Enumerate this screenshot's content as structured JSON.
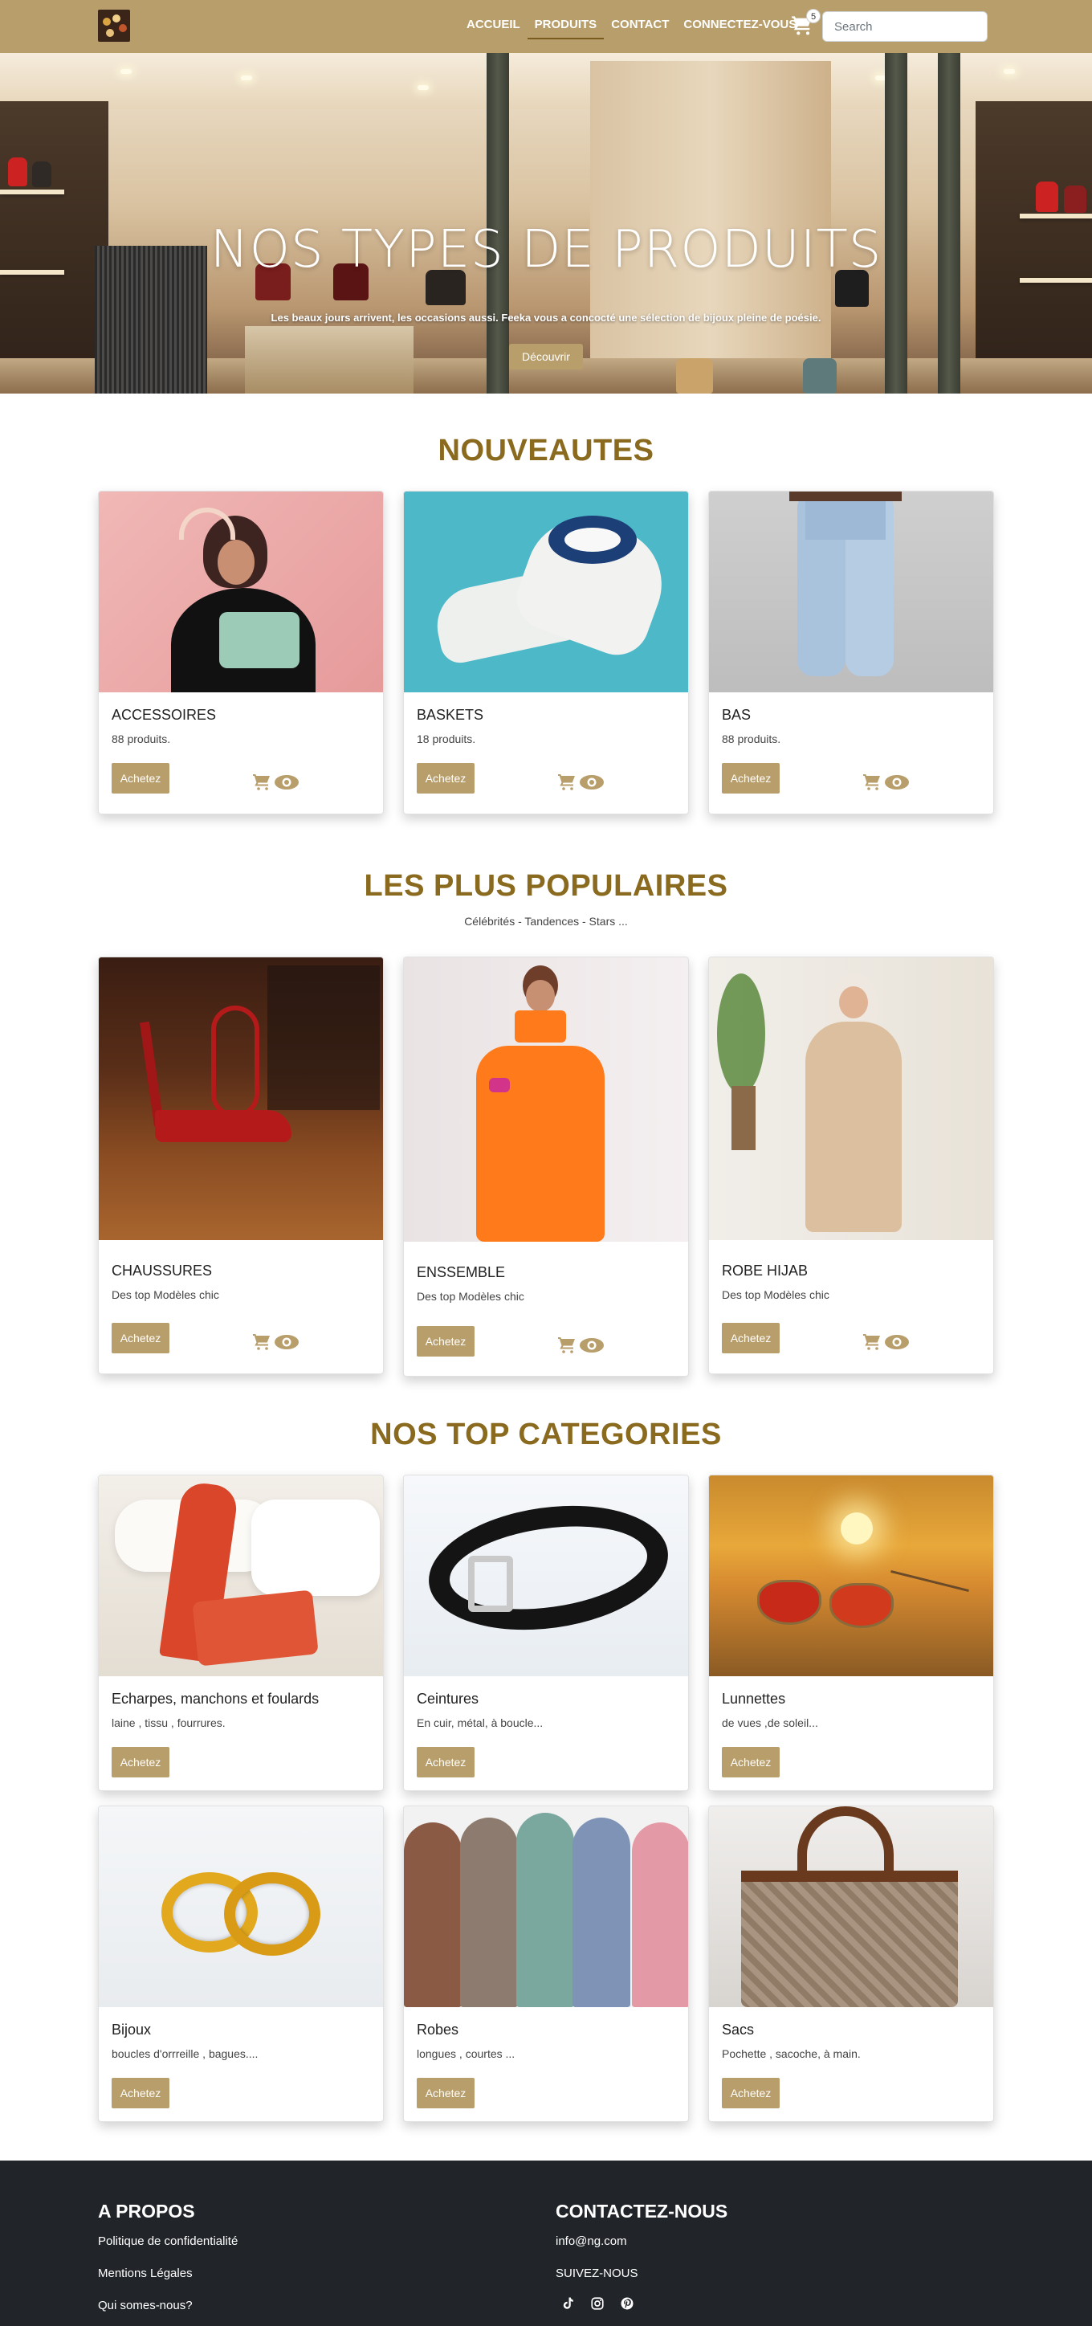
{
  "nav": {
    "links": [
      {
        "label": "ACCUEIL",
        "active": false
      },
      {
        "label": "PRODUITS",
        "active": true
      },
      {
        "label": "CONTACT",
        "active": false
      },
      {
        "label": "CONNECTEZ-VOUS",
        "active": false
      }
    ],
    "cart_icon": "cart-icon",
    "cart_count": "5",
    "search_placeholder": "Search",
    "brand_color": "#b89e6a"
  },
  "hero": {
    "title": "NOS TYPES DE PRODUITS",
    "subtitle": "Les beaux jours arrivent, les occasions aussi. Feeka vous a concocté une sélection de bijoux pleine de poésie.",
    "button": "Découvrir"
  },
  "nouveautes": {
    "title": "NOUVEAUTES",
    "cards": [
      {
        "title": "ACCESSOIRES",
        "desc": "88 produits.",
        "button": "Achetez"
      },
      {
        "title": "BASKETS",
        "desc": "18 produits.",
        "button": "Achetez"
      },
      {
        "title": "BAS",
        "desc": "88 produits.",
        "button": "Achetez"
      }
    ]
  },
  "populaires": {
    "title": "LES PLUS POPULAIRES",
    "subtitle": "Célébrités - Tandences - Stars ...",
    "cards": [
      {
        "title": "CHAUSSURES",
        "desc": "Des top Modèles chic",
        "button": "Achetez"
      },
      {
        "title": "ENSSEMBLE",
        "desc": "Des top Modèles chic",
        "button": "Achetez"
      },
      {
        "title": "ROBE HIJAB",
        "desc": "Des top Modèles chic",
        "button": "Achetez"
      }
    ]
  },
  "categories": {
    "title": "NOS TOP CATEGORIES",
    "cards": [
      {
        "title": "Echarpes, manchons et foulards",
        "desc": "laine , tissu , fourrures.",
        "button": "Achetez"
      },
      {
        "title": "Ceintures",
        "desc": "En cuir, métal, à boucle...",
        "button": "Achetez"
      },
      {
        "title": "Lunnettes",
        "desc": "de vues ,de soleil...",
        "button": "Achetez"
      },
      {
        "title": "Bijoux",
        "desc": "boucles d'orrreille , bagues....",
        "button": "Achetez"
      },
      {
        "title": "Robes",
        "desc": "longues , courtes ...",
        "button": "Achetez"
      },
      {
        "title": "Sacs",
        "desc": "Pochette , sacoche, à main.",
        "button": "Achetez"
      }
    ]
  },
  "footer": {
    "about_title": "A PROPOS",
    "about_links": [
      "Politique de confidentialité",
      "Mentions Légales",
      "Qui somes-nous?"
    ],
    "contact_title": "CONTACTEZ-NOUS",
    "email": "info@ng.com",
    "follow": "SUIVEZ-NOUS",
    "social_icons": [
      "tiktok-icon",
      "instagram-icon",
      "pinterest-icon"
    ]
  }
}
